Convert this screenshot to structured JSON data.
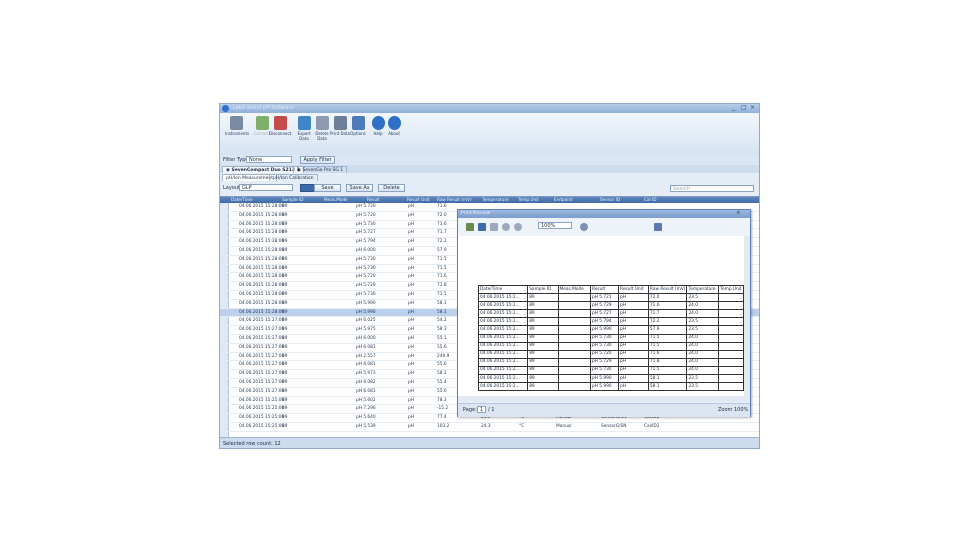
{
  "app": {
    "title": "LabX direct pH Software",
    "controls": {
      "min": "_",
      "max": "□",
      "close": "×"
    }
  },
  "ribbon": [
    {
      "label": "Instruments",
      "icon": "instruments-icon",
      "color": "#7a8aa0",
      "disabled": false
    },
    {
      "label": "Connect",
      "icon": "connect-icon",
      "color": "#7fb06a",
      "disabled": true
    },
    {
      "label": "Disconnect",
      "icon": "disconnect-icon",
      "color": "#c44b4b",
      "disabled": false
    },
    {
      "label": "Export Data",
      "icon": "export-icon",
      "color": "#3f86c9",
      "disabled": false
    },
    {
      "label": "Delete Data",
      "icon": "delete-icon",
      "color": "#8d9bb0",
      "disabled": false
    },
    {
      "label": "Print Data",
      "icon": "print-icon",
      "color": "#6b7f99",
      "disabled": false
    },
    {
      "label": "Options",
      "icon": "options-icon",
      "color": "#4d7ab8",
      "disabled": false
    },
    {
      "label": "Help",
      "icon": "help-icon",
      "color": "#2f6fc6",
      "disabled": false
    },
    {
      "label": "About",
      "icon": "about-icon",
      "color": "#2f6fc6",
      "disabled": false
    }
  ],
  "filter": {
    "label": "Filter Type:",
    "value": "None",
    "button": "Apply Filter"
  },
  "doc_tabs": [
    "SevenCompact Duo S213 1",
    "SevenGo Pro SG 1"
  ],
  "sub_tabs": [
    "pH/Ion Measurement",
    "pH/Ion Calibration"
  ],
  "layout": {
    "label": "Layout:",
    "value": "GLP",
    "save": "Save",
    "save_as": "Save As",
    "delete": "Delete",
    "search_placeholder": "Search"
  },
  "grid": {
    "columns": [
      "Date/Time",
      "Sample ID",
      "Meas.Mode",
      "Result",
      "Result Unit",
      "Raw Result (mV)",
      "Temperature",
      "Temp.Unit",
      "Endpoint",
      "Sensor ID",
      "Cal ID"
    ],
    "rows": [
      [
        "04.06.2015 15:28:00",
        "89",
        "",
        "pH  5.720",
        "pH",
        "71.6"
      ],
      [
        "04.06.2015 15:28:00",
        "89",
        "",
        "pH  5.720",
        "pH",
        "72.0"
      ],
      [
        "04.06.2015 15:28:00",
        "89",
        "",
        "pH  5.730",
        "pH",
        "71.6"
      ],
      [
        "04.06.2015 15:28:00",
        "89",
        "",
        "pH  5.727",
        "pH",
        "71.7"
      ],
      [
        "04.06.2015 15:28:00",
        "89",
        "",
        "pH  5.794",
        "pH",
        "72.2"
      ],
      [
        "04.06.2015 15:28:00",
        "89",
        "",
        "pH  6.000",
        "pH",
        "57.9"
      ],
      [
        "04.06.2015 15:28:00",
        "89",
        "",
        "pH  5.730",
        "pH",
        "71.5"
      ],
      [
        "04.06.2015 15:28:00",
        "89",
        "",
        "pH  5.730",
        "pH",
        "71.5"
      ],
      [
        "04.06.2015 15:28:00",
        "89",
        "",
        "pH  5.720",
        "pH",
        "71.6"
      ],
      [
        "04.06.2015 15:28:00",
        "89",
        "",
        "pH  5.729",
        "pH",
        "71.8"
      ],
      [
        "04.06.2015 15:28:00",
        "89",
        "",
        "pH  5.730",
        "pH",
        "71.5"
      ],
      [
        "04.06.2015 15:28:00",
        "89",
        "",
        "pH  5.990",
        "pH",
        "58.1"
      ],
      [
        "04.06.2015 15:28:00",
        "89",
        "",
        "pH  5.990",
        "pH",
        "58.1"
      ],
      [
        "04.06.2015 15:27:00",
        "89",
        "",
        "pH  6.025",
        "pH",
        "54.2"
      ],
      [
        "04.06.2015 15:27:00",
        "89",
        "",
        "pH  5.975",
        "pH",
        "58.3"
      ],
      [
        "04.06.2015 15:27:00",
        "89",
        "",
        "pH  6.000",
        "pH",
        "55.1"
      ],
      [
        "04.06.2015 15:27:00",
        "89",
        "",
        "pH  6.081",
        "pH",
        "55.6"
      ],
      [
        "04.06.2015 15:27:00",
        "89",
        "",
        "pH  2.557",
        "pH",
        "249.9"
      ],
      [
        "04.06.2015 15:27:00",
        "89",
        "",
        "pH  6.081",
        "pH",
        "55.6"
      ],
      [
        "04.06.2015 15:27:00",
        "89",
        "",
        "pH  5.973",
        "pH",
        "58.2"
      ],
      [
        "04.06.2015 15:27:00",
        "89",
        "",
        "pH  6.082",
        "pH",
        "55.4"
      ],
      [
        "04.06.2015 15:27:00",
        "89",
        "",
        "pH  6.081",
        "pH",
        "55.6"
      ],
      [
        "04.06.2015 15:25:00",
        "89",
        "",
        "pH  5.602",
        "pH",
        "78.3"
      ],
      [
        "04.06.2015 15:25:00",
        "89",
        "",
        "pH  7.296",
        "pH",
        "-15.2"
      ],
      [
        "04.06.2015 15:25:00",
        "89",
        "",
        "pH  5.640",
        "pH",
        "77.4"
      ],
      [
        "04.06.2015 15:25:00",
        "89",
        "",
        "pH  5.539",
        "pH",
        "103.2"
      ]
    ],
    "selected_row": 12,
    "tail": [
      [
        "24.0",
        "°C",
        "Manual",
        "SensorG/SN",
        "Cal/ID2"
      ],
      [
        "24.0",
        "°C",
        "Manual",
        "SensorG/SN",
        "Cal/ID2"
      ],
      [
        "24.3",
        "°C",
        "Manual",
        "SensorG/SN",
        "Cal/ID2"
      ]
    ]
  },
  "status": {
    "text": "Selected row count: 12"
  },
  "print_preview": {
    "title": "Print Preview",
    "zoom": "100%",
    "page_label": "Page:",
    "page_value": "1",
    "page_of": "/ 1",
    "zoom_label": "Zoom 100%",
    "columns": [
      "Date/Time",
      "Sample ID",
      "Meas.Mode",
      "Result",
      "Result Unit",
      "Raw Result (mV)",
      "Temperature",
      "Temp.Unit"
    ],
    "rows": [
      [
        "04.06.2015 15:2...",
        "89",
        "",
        "pH 5.721",
        "pH",
        "72.0",
        "23.5",
        ""
      ],
      [
        "04.06.2015 15:2...",
        "89",
        "",
        "pH 5.729",
        "pH",
        "71.6",
        "24.0",
        ""
      ],
      [
        "04.06.2015 15:2...",
        "89",
        "",
        "pH 5.727",
        "pH",
        "71.7",
        "24.0",
        ""
      ],
      [
        "04.06.2015 15:2...",
        "89",
        "",
        "pH 5.794",
        "pH",
        "72.2",
        "23.5",
        ""
      ],
      [
        "04.06.2015 15:2...",
        "89",
        "",
        "pH 5.990",
        "pH",
        "57.9",
        "23.5",
        ""
      ],
      [
        "04.06.2015 15:2...",
        "89",
        "",
        "pH 5.730",
        "pH",
        "71.5",
        "24.0",
        ""
      ],
      [
        "04.06.2015 15:2...",
        "89",
        "",
        "pH 5.730",
        "pH",
        "71.5",
        "24.0",
        ""
      ],
      [
        "04.06.2015 15:2...",
        "89",
        "",
        "pH 5.720",
        "pH",
        "71.6",
        "24.0",
        ""
      ],
      [
        "04.06.2015 15:2...",
        "89",
        "",
        "pH 5.729",
        "pH",
        "71.8",
        "24.0",
        ""
      ],
      [
        "04.06.2015 15:2...",
        "89",
        "",
        "pH 5.730",
        "pH",
        "71.5",
        "24.0",
        ""
      ],
      [
        "04.06.2015 15:2...",
        "89",
        "",
        "pH 5.990",
        "pH",
        "58.1",
        "23.5",
        ""
      ],
      [
        "04.06.2015 15:2...",
        "89",
        "",
        "pH 5.990",
        "pH",
        "58.1",
        "23.5",
        ""
      ]
    ]
  }
}
